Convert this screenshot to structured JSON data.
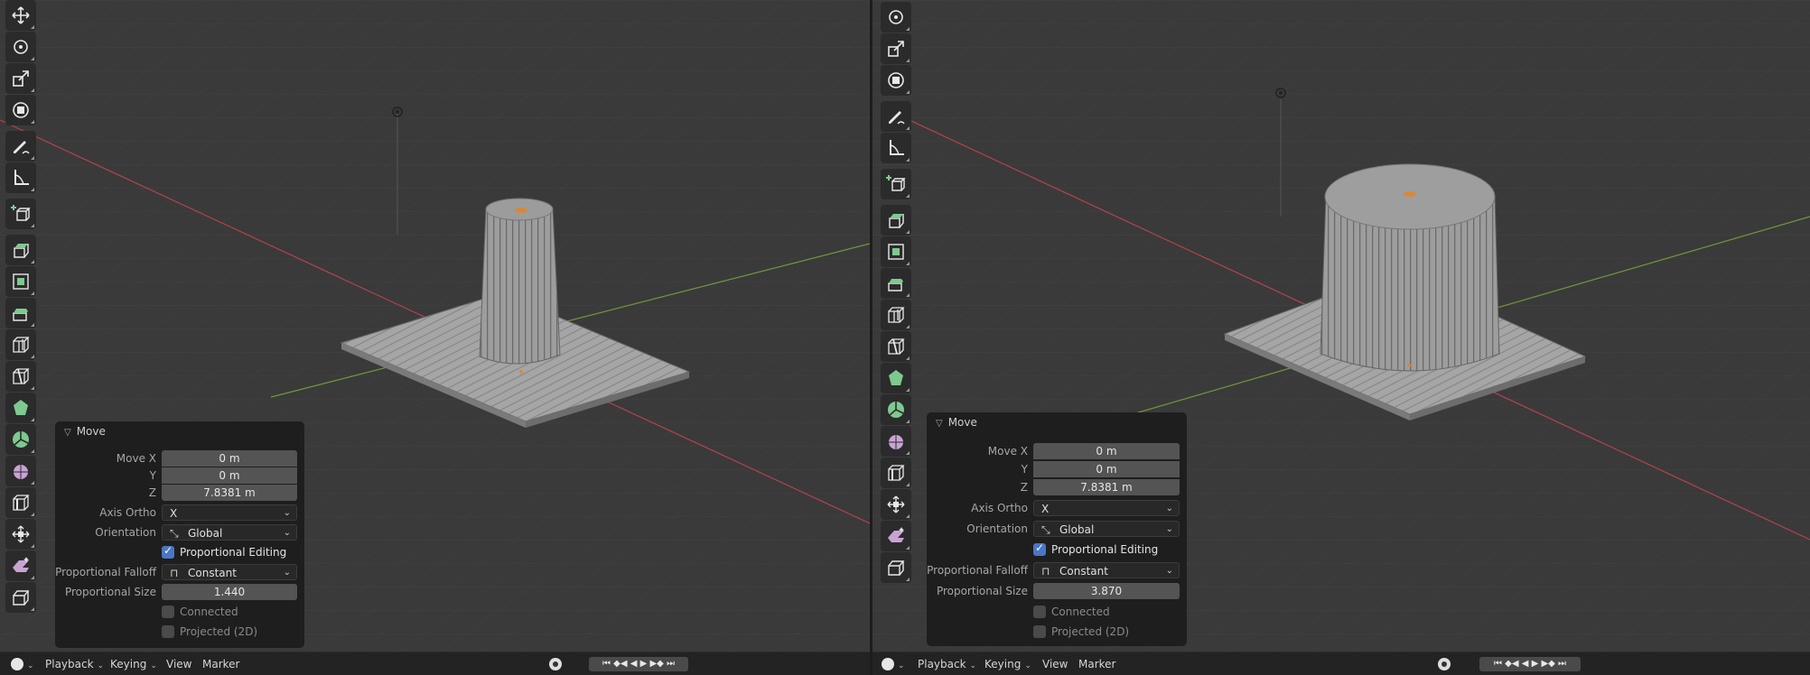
{
  "panels": [
    {
      "redo": {
        "title": "Move",
        "move_x_label": "Move X",
        "move_x": "0 m",
        "y_label": "Y",
        "y": "0 m",
        "z_label": "Z",
        "z": "7.8381 m",
        "axis_ortho_label": "Axis Ortho",
        "axis_ortho": "X",
        "orientation_label": "Orientation",
        "orientation": "Global",
        "prop_edit_label": "Proportional Editing",
        "prop_edit": true,
        "falloff_label": "Proportional Falloff",
        "falloff": "Constant",
        "size_label": "Proportional Size",
        "size": "1.440",
        "connected_label": "Connected",
        "connected": false,
        "projected_label": "Projected (2D)",
        "projected": false
      },
      "timeline": {
        "playback": "Playback",
        "keying": "Keying",
        "view": "View",
        "marker": "Marker"
      }
    },
    {
      "redo": {
        "title": "Move",
        "move_x_label": "Move X",
        "move_x": "0 m",
        "y_label": "Y",
        "y": "0 m",
        "z_label": "Z",
        "z": "7.8381 m",
        "axis_ortho_label": "Axis Ortho",
        "axis_ortho": "X",
        "orientation_label": "Orientation",
        "orientation": "Global",
        "prop_edit_label": "Proportional Editing",
        "prop_edit": true,
        "falloff_label": "Proportional Falloff",
        "falloff": "Constant",
        "size_label": "Proportional Size",
        "size": "3.870",
        "connected_label": "Connected",
        "connected": false,
        "projected_label": "Projected (2D)",
        "projected": false
      },
      "timeline": {
        "playback": "Playback",
        "keying": "Keying",
        "view": "View",
        "marker": "Marker"
      }
    }
  ],
  "toolbar_icons": [
    "move-icon",
    "rotate-icon",
    "scale-icon",
    "transform-icon",
    "annotate-icon",
    "measure-icon",
    "add-cube-icon",
    "extrude-icon",
    "inset-icon",
    "bevel-icon",
    "loop-cut-icon",
    "knife-icon",
    "poly-build-icon",
    "spin-icon",
    "smooth-icon",
    "edge-slide-icon",
    "shrink-fatten-icon",
    "shear-icon",
    "rip-icon"
  ],
  "colors": {
    "viewport_bg": "#3a3a3a",
    "x_axis": "#b5424d",
    "y_axis": "#6e9a3a",
    "accent": "#4a77c4",
    "tool_green": "#7ec98f",
    "mesh": "#a9a9a9"
  }
}
